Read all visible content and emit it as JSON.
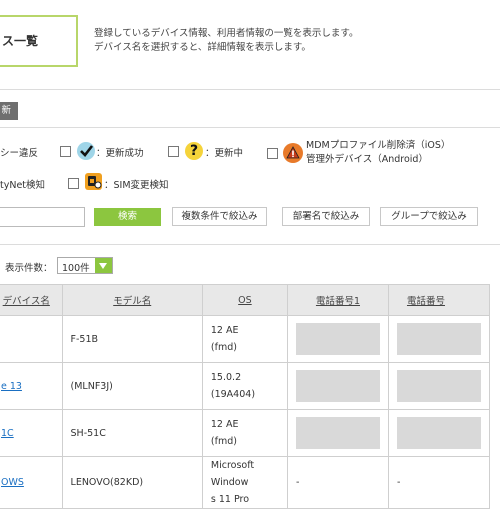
{
  "header": {
    "title": "ス一覧",
    "description_line1": "登録しているデバイス情報、利用者情報の一覧を表示します。",
    "description_line2": "デバイス名を選択すると、詳細情報を表示します。"
  },
  "toolbar": {
    "new_label": "新"
  },
  "legend": {
    "policy_violation": "シー違反",
    "update_success": "：更新成功",
    "updating": "：更新中",
    "mdm_removed_line1": "MDMプロファイル削除済（iOS）",
    "mdm_removed_line2": "管理外デバイス（Android）",
    "safetynet": "tyNet検知",
    "sim_change": "：SIM変更検知"
  },
  "search": {
    "input_value": "",
    "search_label": "検索",
    "filter_multi_label": "複数条件で絞込み",
    "filter_dept_label": "部署名で絞込み",
    "filter_group_label": "グループで絞込み"
  },
  "display": {
    "label": "表示件数：",
    "selected": "100件"
  },
  "table": {
    "headers": [
      "デバイス名",
      "モデル名",
      "OS",
      "電話番号1",
      "電話番号"
    ],
    "rows": [
      {
        "device": "",
        "model": "F-51B",
        "os": [
          "12 AE",
          "(fmd)"
        ],
        "tel1": "",
        "tel2": ""
      },
      {
        "device": "e 13",
        "model": "(MLNF3J)",
        "os": [
          "15.0.2 (19A404)"
        ],
        "tel1": "",
        "tel2": ""
      },
      {
        "device": "1C",
        "model": "SH-51C",
        "os": [
          "12 AE",
          "(fmd)"
        ],
        "tel1": "",
        "tel2": ""
      },
      {
        "device": "OWS",
        "model": "LENOVO(82KD)",
        "os": [
          "Microsoft Window",
          "s 11 Pro"
        ],
        "tel1": "-",
        "tel2": "-"
      }
    ]
  },
  "colors": {
    "accent": "#8cc63f",
    "title_border": "#b8d66a",
    "link": "#1a6fc2"
  }
}
